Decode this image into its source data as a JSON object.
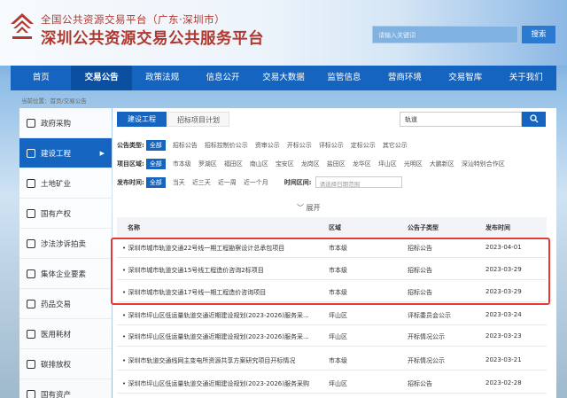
{
  "header": {
    "subtitle": "全国公共资源交易平台（广东·深圳市）",
    "title": "深圳公共资源交易公共服务平台",
    "search_placeholder": "请输入关键词",
    "search_button": "搜索"
  },
  "nav": {
    "items": [
      "首页",
      "交易公告",
      "政策法规",
      "信息公开",
      "交易大数据",
      "监管信息",
      "营商环境",
      "交易智库",
      "关于我们"
    ]
  },
  "breadcrumb": "当前位置：首页/交易公告",
  "sidebar": {
    "items": [
      "政府采购",
      "建设工程",
      "土地矿业",
      "国有产权",
      "涉法涉诉拍卖",
      "集体企业要素",
      "药品交易",
      "医用耗材",
      "碳排放权",
      "国有资产"
    ]
  },
  "tabs": [
    "建设工程",
    "招标项目计划"
  ],
  "keyword": {
    "value": "轨道",
    "button_icon": "search-icon"
  },
  "filters": {
    "type": {
      "label": "公告类型:",
      "options": [
        "全部",
        "招标公告",
        "招标控制价公示",
        "资审公示",
        "开标公示",
        "评标公示",
        "定标公示",
        "其它公示"
      ]
    },
    "region": {
      "label": "项目区域:",
      "options": [
        "全部",
        "市本级",
        "罗湖区",
        "福田区",
        "南山区",
        "宝安区",
        "龙岗区",
        "盐田区",
        "龙华区",
        "坪山区",
        "光明区",
        "大鹏新区",
        "深汕特别合作区"
      ]
    },
    "time": {
      "label": "发布时间:",
      "options": [
        "全部",
        "当天",
        "近三天",
        "近一周",
        "近一个月"
      ],
      "range_label": "时间区间:",
      "range_placeholder": "请选择日期范围"
    }
  },
  "expand_label": "展开",
  "table": {
    "headers": [
      "名称",
      "区域",
      "公告子类型",
      "发布时间"
    ],
    "rows": [
      {
        "name": "深圳市城市轨道交通22号线一期工程勘察设计总承包项目",
        "region": "市本级",
        "type": "招标公告",
        "date": "2023-04-01"
      },
      {
        "name": "深圳市城市轨道交通15号线工程造价咨询2标项目",
        "region": "市本级",
        "type": "招标公告",
        "date": "2023-03-29"
      },
      {
        "name": "深圳市城市轨道交通17号线一期工程造价咨询项目",
        "region": "市本级",
        "type": "招标公告",
        "date": "2023-03-29"
      },
      {
        "name": "深圳市坪山区低运量轨道交通近期建设规划(2023-2026)服务采...",
        "region": "坪山区",
        "type": "评标委员会公示",
        "date": "2023-03-24"
      },
      {
        "name": "深圳市坪山区低运量轨道交通近期建设规划(2023-2026)服务采...",
        "region": "坪山区",
        "type": "开标情况公示",
        "date": "2023-03-23"
      },
      {
        "name": "深圳市轨道交通线网主变电所资源共享方案研究项目开标情况",
        "region": "市本级",
        "type": "开标情况公示",
        "date": "2023-03-21"
      },
      {
        "name": "深圳市坪山区低运量轨道交通近期建设规划(2023-2026)服务采购",
        "region": "坪山区",
        "type": "招标公告",
        "date": "2023-02-28"
      }
    ]
  },
  "colors": {
    "primary": "#1565c0",
    "brand_red": "#b0382e",
    "highlight": "#e53935"
  }
}
